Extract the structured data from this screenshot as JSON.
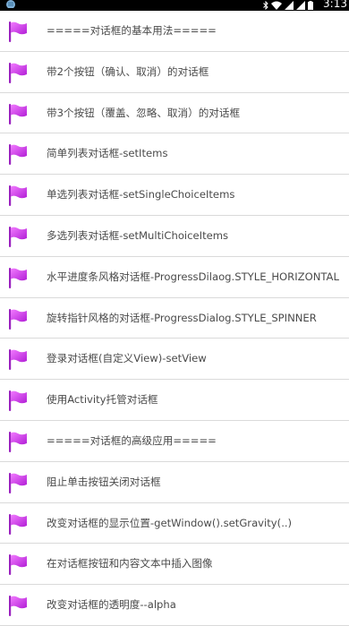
{
  "status_bar": {
    "time": "3:13",
    "app_icon": "android-debug-icon",
    "icons": [
      "bluetooth-icon",
      "wifi-icon",
      "signal-icon",
      "signal-icon",
      "battery-icon"
    ]
  },
  "list": {
    "item_icon": "purple-flag-icon",
    "items": [
      {
        "label": "=====对话框的基本用法====="
      },
      {
        "label": "带2个按钮（确认、取消）的对话框"
      },
      {
        "label": "带3个按钮（覆盖、忽略、取消）的对话框"
      },
      {
        "label": "简单列表对话框-setItems"
      },
      {
        "label": "单选列表对话框-setSingleChoiceItems"
      },
      {
        "label": "多选列表对话框-setMultiChoiceItems"
      },
      {
        "label": "水平进度条风格对话框-ProgressDilaog.STYLE_HORIZONTAL"
      },
      {
        "label": "旋转指针风格的对话框-ProgressDialog.STYLE_SPINNER"
      },
      {
        "label": "登录对话框(自定义View)-setView"
      },
      {
        "label": "使用Activity托管对话框"
      },
      {
        "label": "=====对话框的高级应用====="
      },
      {
        "label": "阻止单击按钮关闭对话框"
      },
      {
        "label": "改变对话框的显示位置-getWindow().setGravity(..)"
      },
      {
        "label": "在对话框按钮和内容文本中插入图像"
      },
      {
        "label": "改变对话框的透明度--alpha"
      }
    ]
  }
}
